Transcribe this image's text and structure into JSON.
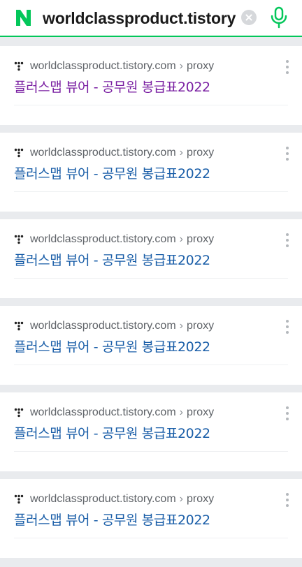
{
  "search": {
    "query": "worldclassproduct.tistory.com",
    "logo": "N",
    "logo_color": "#03c75a",
    "mic_color": "#03c75a"
  },
  "icons": {
    "favicon": "tistory-dots-icon",
    "clear": "close-icon",
    "mic": "microphone-icon",
    "more": "more-vertical-icon"
  },
  "colors": {
    "visited_title": "#7a1fa2",
    "link_title": "#1a5ea8",
    "url": "#5f6368",
    "divider": "#e9ebee"
  },
  "results": [
    {
      "domain": "worldclassproduct.tistory.com",
      "sep": "›",
      "path": "proxy",
      "title": "플러스맵 뷰어 - 공무원 봉급표2022",
      "visited": true
    },
    {
      "domain": "worldclassproduct.tistory.com",
      "sep": "›",
      "path": "proxy",
      "title": "플러스맵 뷰어 - 공무원 봉급표2022",
      "visited": false
    },
    {
      "domain": "worldclassproduct.tistory.com",
      "sep": "›",
      "path": "proxy",
      "title": "플러스맵 뷰어 - 공무원 봉급표2022",
      "visited": false
    },
    {
      "domain": "worldclassproduct.tistory.com",
      "sep": "›",
      "path": "proxy",
      "title": "플러스맵 뷰어 - 공무원 봉급표2022",
      "visited": false
    },
    {
      "domain": "worldclassproduct.tistory.com",
      "sep": "›",
      "path": "proxy",
      "title": "플러스맵 뷰어 - 공무원 봉급표2022",
      "visited": false
    },
    {
      "domain": "worldclassproduct.tistory.com",
      "sep": "›",
      "path": "proxy",
      "title": "플러스맵 뷰어 - 공무원 봉급표2022",
      "visited": false
    }
  ]
}
